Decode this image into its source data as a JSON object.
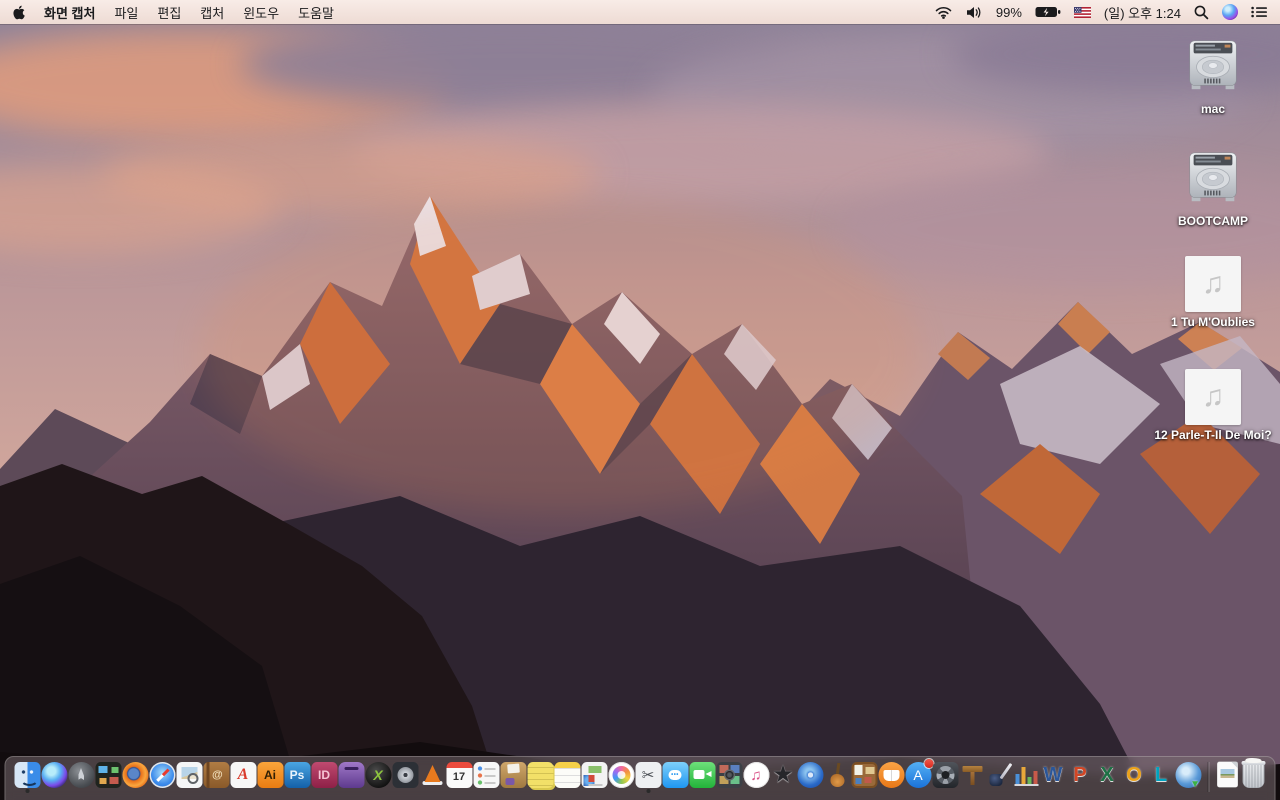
{
  "menu_bar": {
    "apple_menu": "apple-logo",
    "app_name": "화면 캡처",
    "menus": [
      "파일",
      "편집",
      "캡처",
      "윈도우",
      "도움말"
    ],
    "status": {
      "wifi": "wifi-icon",
      "volume": "volume-icon",
      "battery_percent": "99%",
      "battery_state": "charging",
      "input_source": "us-flag",
      "clock": "(일) 오후 1:24",
      "spotlight": "search-icon",
      "siri": "siri-icon",
      "notification_center": "list-icon"
    }
  },
  "wallpaper": {
    "name": "macOS Sierra mountain at sunset",
    "sky_top": "#8f8399",
    "cloud_pink": "#e59d7c",
    "alpenglow": "#d27642",
    "rock_shadow": "#473a4d",
    "foreground_rock": "#1f1518"
  },
  "desktop": {
    "icons": [
      {
        "id": "mac",
        "label": "mac",
        "type": "drive"
      },
      {
        "id": "bootcamp",
        "label": "BOOTCAMP",
        "type": "drive"
      },
      {
        "id": "song-1",
        "label": "1 Tu M'Oublies",
        "type": "audio",
        "note_glyph": "♫"
      },
      {
        "id": "song-2",
        "label": "12 Parle-T-Il De Moi?",
        "type": "audio",
        "note_glyph": "♫"
      }
    ]
  },
  "dock": {
    "apps": [
      {
        "id": "finder",
        "label": "Finder",
        "running": true
      },
      {
        "id": "siri",
        "label": "Siri"
      },
      {
        "id": "launchpad",
        "label": "Launchpad"
      },
      {
        "id": "mission-control",
        "label": "Mission Control"
      },
      {
        "id": "firefox",
        "label": "Firefox"
      },
      {
        "id": "safari",
        "label": "Safari"
      },
      {
        "id": "preview",
        "label": "Preview"
      },
      {
        "id": "contacts",
        "label": "Contacts"
      },
      {
        "id": "acrobat",
        "label": "Adobe Acrobat",
        "glyph": "A"
      },
      {
        "id": "illustrator",
        "label": "Adobe Illustrator",
        "glyph": "Ai"
      },
      {
        "id": "photoshop",
        "label": "Adobe Photoshop",
        "glyph": "Ps"
      },
      {
        "id": "indesign",
        "label": "Adobe InDesign",
        "glyph": "ID"
      },
      {
        "id": "toast",
        "label": "Toast"
      },
      {
        "id": "green-x",
        "label": "X Utility",
        "glyph": "X"
      },
      {
        "id": "drive-tool",
        "label": "Disk Utility App"
      },
      {
        "id": "vlc",
        "label": "VLC"
      },
      {
        "id": "calendar",
        "label": "Calendar",
        "glyph": "17"
      },
      {
        "id": "reminders",
        "label": "Reminders"
      },
      {
        "id": "unarchiver",
        "label": "Unarchiver"
      },
      {
        "id": "stickies",
        "label": "Stickies"
      },
      {
        "id": "notes",
        "label": "Notes"
      },
      {
        "id": "iweb",
        "label": "iWeb"
      },
      {
        "id": "photos",
        "label": "Photos"
      },
      {
        "id": "grab",
        "label": "화면 캡처 (Grab)",
        "glyph": "✂",
        "running": true
      },
      {
        "id": "messages",
        "label": "Messages",
        "glyph": "•••"
      },
      {
        "id": "facetime",
        "label": "FaceTime"
      },
      {
        "id": "photo-booth",
        "label": "Photo Booth"
      },
      {
        "id": "itunes",
        "label": "iTunes",
        "glyph": "♫"
      },
      {
        "id": "imovie",
        "label": "iMovie",
        "glyph": "★"
      },
      {
        "id": "idvd",
        "label": "iDVD"
      },
      {
        "id": "garageband",
        "label": "GarageBand"
      },
      {
        "id": "corkboard",
        "label": "Corkboard App"
      },
      {
        "id": "ibooks",
        "label": "iBooks"
      },
      {
        "id": "app-store",
        "label": "App Store",
        "glyph": "A",
        "badge": true
      },
      {
        "id": "aperture",
        "label": "Aperture"
      },
      {
        "id": "keynote",
        "label": "Keynote"
      },
      {
        "id": "pages",
        "label": "Pages"
      },
      {
        "id": "numbers",
        "label": "Numbers"
      },
      {
        "id": "word",
        "label": "Microsoft Word",
        "glyph": "W"
      },
      {
        "id": "powerpoint",
        "label": "Microsoft PowerPoint",
        "glyph": "P"
      },
      {
        "id": "excel",
        "label": "Microsoft Excel",
        "glyph": "X"
      },
      {
        "id": "outlook",
        "label": "Microsoft Outlook",
        "glyph": "O"
      },
      {
        "id": "lync",
        "label": "Microsoft Lync",
        "glyph": "L"
      },
      {
        "id": "downloader",
        "label": "Download Manager"
      }
    ],
    "files": [
      {
        "id": "document",
        "label": "Document"
      }
    ],
    "trash": {
      "id": "trash",
      "label": "Trash",
      "full": true
    }
  }
}
